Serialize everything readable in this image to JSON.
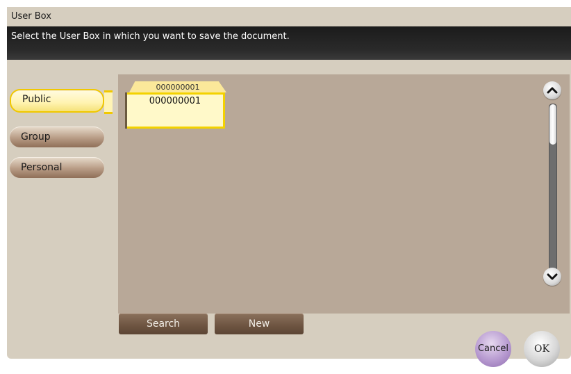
{
  "window": {
    "title": "User Box"
  },
  "message": "Select the User Box in which you want to save the document.",
  "tabs": [
    {
      "label": "Public",
      "active": true
    },
    {
      "label": "Group",
      "active": false
    },
    {
      "label": "Personal",
      "active": false
    }
  ],
  "boxes": [
    {
      "tab_label": "000000001",
      "name": "000000001",
      "selected": true
    }
  ],
  "buttons": {
    "search": "Search",
    "new": "New",
    "cancel": "Cancel",
    "ok": "OK"
  },
  "icons": {
    "scroll_up": "chevron-up-icon",
    "scroll_down": "chevron-down-icon"
  },
  "colors": {
    "accent_yellow": "#f3d200",
    "panel_bg": "#d6cebf",
    "content_bg": "#b8a898",
    "header_bg": "#1b1b1b",
    "action_button": "#6d5441"
  }
}
